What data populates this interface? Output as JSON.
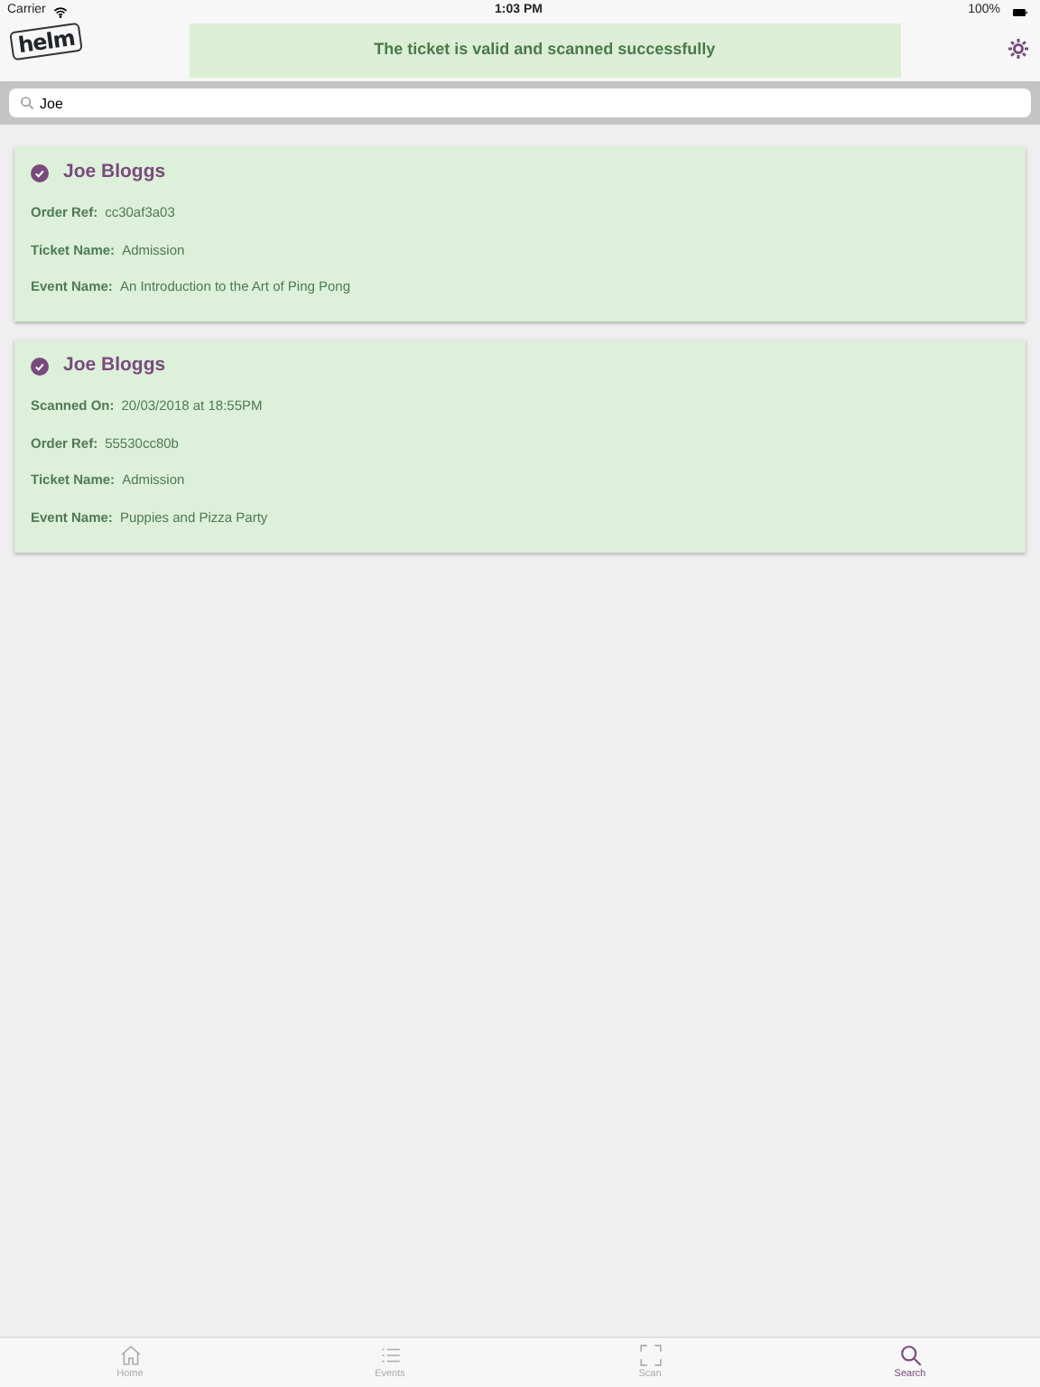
{
  "status_bar": {
    "carrier": "Carrier",
    "time": "1:03 PM",
    "battery": "100%"
  },
  "header": {
    "logo": "helm",
    "toast": "The ticket is valid and scanned successfully"
  },
  "search": {
    "value": "Joe"
  },
  "results": [
    {
      "name": "Joe Bloggs",
      "scanned": true,
      "fields": [
        {
          "label": "Order Ref:",
          "value": "cc30af3a03"
        },
        {
          "label": "Ticket Name:",
          "value": "Admission"
        },
        {
          "label": "Event Name:",
          "value": "An Introduction to the Art of Ping Pong"
        }
      ]
    },
    {
      "name": "Joe Bloggs",
      "scanned": true,
      "fields": [
        {
          "label": "Scanned On:",
          "value": "20/03/2018 at 18:55PM"
        },
        {
          "label": "Order Ref:",
          "value": "55530cc80b"
        },
        {
          "label": "Ticket Name:",
          "value": "Admission"
        },
        {
          "label": "Event Name:",
          "value": "Puppies and Pizza Party"
        }
      ]
    }
  ],
  "tabs": [
    {
      "kind": "home",
      "label": "Home",
      "selected": false
    },
    {
      "kind": "list",
      "label": "Events",
      "selected": false
    },
    {
      "kind": "scan",
      "label": "Scan",
      "selected": false
    },
    {
      "kind": "search",
      "label": "Search",
      "selected": true
    }
  ]
}
